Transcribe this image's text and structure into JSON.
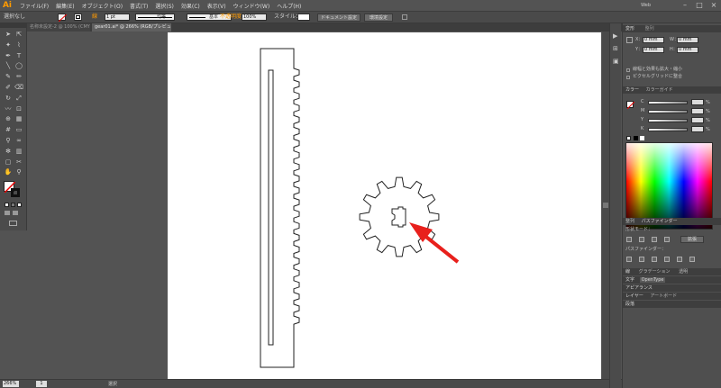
{
  "app": {
    "logo": "Ai",
    "menu": [
      "ファイル(F)",
      "編集(E)",
      "オブジェクト(O)",
      "書式(T)",
      "選択(S)",
      "効果(C)",
      "表示(V)",
      "ウィンドウ(W)",
      "ヘルプ(H)"
    ],
    "workspace": "Web"
  },
  "controlbar": {
    "selection_label": "選択なし",
    "stroke_label": "線",
    "stroke_weight": "1 pt",
    "stroke_profile": "均等",
    "brush_label": "基本",
    "opacity_label": "不透明度",
    "opacity_value": "100%",
    "style_label": "スタイル：",
    "doc_setup_button": "ドキュメント設定",
    "preferences_button": "環境設定"
  },
  "tabs": [
    {
      "label": "名称未設定-2 @ 100% (CMYK/プレビュー)",
      "active": false
    },
    {
      "label": "gear01.ai* @ 266% (RGB/プレビュー)",
      "active": true
    }
  ],
  "statusbar": {
    "zoom": "266%",
    "page": "1",
    "status": "選択"
  },
  "panels": {
    "transform": {
      "tabs": [
        "変形",
        "整列"
      ],
      "x_label": "X：",
      "y_label": "Y：",
      "w_label": "W：",
      "h_label": "H：",
      "x_value": "0 mm",
      "y_value": "0 mm",
      "w_value": "0 mm",
      "h_value": "0 mm",
      "option1": "線幅と効果も拡大・縮小",
      "option2": "ピクセルグリッドに整合"
    },
    "color": {
      "tabs": [
        "カラー",
        "カラーガイド"
      ],
      "channels": [
        {
          "label": "C",
          "value": "%"
        },
        {
          "label": "M",
          "value": "%"
        },
        {
          "label": "Y",
          "value": "%"
        },
        {
          "label": "K",
          "value": "%"
        }
      ]
    },
    "pathfinder": {
      "tabs": [
        "整列",
        "パスファインダー"
      ],
      "shape_modes_label": "形状モード：",
      "expand_button": "拡張",
      "pathfinders_label": "パスファインダー："
    },
    "stroke": {
      "tabs": [
        "線",
        "グラデーション",
        "透明"
      ]
    },
    "character": {
      "tabs": [
        "文字",
        "OpenType"
      ]
    },
    "appearance": {
      "tabs": [
        "アピアランス"
      ]
    },
    "layers": {
      "tabs": [
        "レイヤー",
        "アートボード"
      ]
    },
    "paragraph": {
      "tabs": [
        "段落"
      ]
    }
  },
  "colors": {
    "accent": "#ff9a00",
    "artboard": "#ffffff",
    "workspace_bg": "#535353",
    "arrow": "#e8201c"
  },
  "icons": {
    "tools": [
      "selection-tool",
      "direct-selection-tool",
      "magic-wand-tool",
      "lasso-tool",
      "pen-tool",
      "type-tool",
      "line-tool",
      "ellipse-tool",
      "paintbrush-tool",
      "pencil-tool",
      "blob-brush-tool",
      "eraser-tool",
      "rotate-tool",
      "scale-tool",
      "warp-tool",
      "free-transform-tool",
      "shape-builder-tool",
      "perspective-grid-tool",
      "mesh-tool",
      "gradient-tool",
      "eyedropper-tool",
      "blend-tool",
      "symbol-sprayer-tool",
      "column-graph-tool",
      "artboard-tool",
      "slice-tool",
      "hand-tool",
      "zoom-tool"
    ]
  }
}
